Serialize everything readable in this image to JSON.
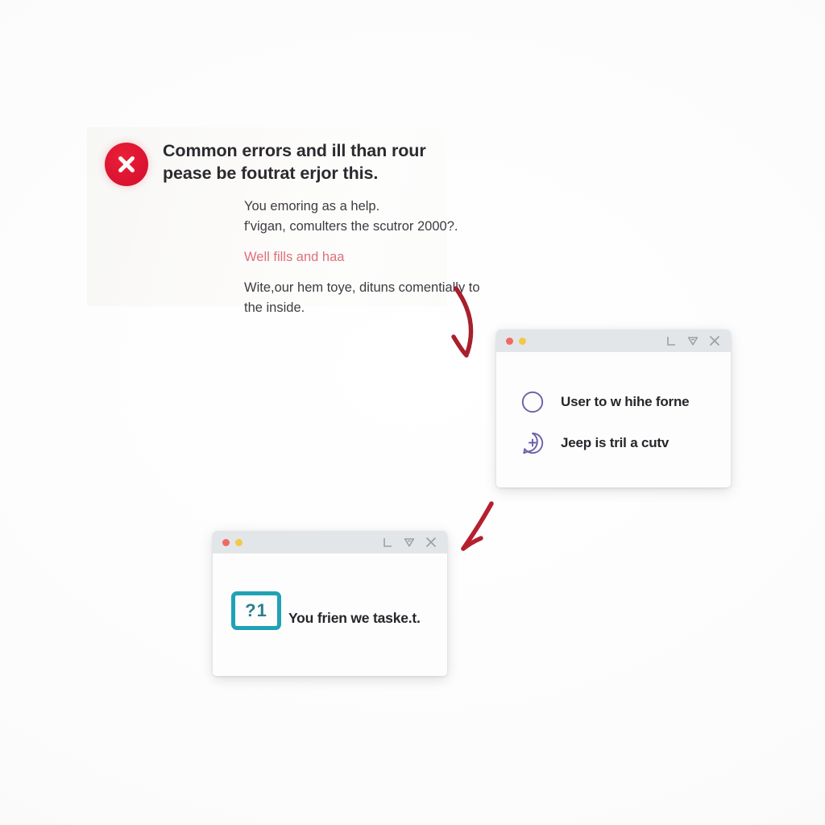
{
  "canvas": {
    "background_color": "#fdfdfd"
  },
  "error_panel": {
    "icon": "error-x-circle-icon",
    "icon_color": "#dc1431",
    "heading_lines": [
      "Common errors and ill than rour",
      "pease be foutrat erjor this."
    ],
    "paragraphs": [
      {
        "accent": false,
        "lines": [
          "You emoring as a help.",
          "f'vigan, comulters the scutror 2000?."
        ]
      },
      {
        "accent": true,
        "lines": [
          "Well fills and haa"
        ]
      },
      {
        "accent": false,
        "lines": [
          "Wite,our hem toye, dituns comentially to",
          "the inside."
        ]
      }
    ],
    "accent_color": "#e0707c",
    "text_color": "#3c3c42"
  },
  "windows": [
    {
      "id": "options-window",
      "titlebar": {
        "dots": [
          "red",
          "yellow"
        ],
        "dot_colors": {
          "red": "#ee6a63",
          "yellow": "#f2c948"
        },
        "icons": [
          "corner-l-icon",
          "shield-icon",
          "close-x-icon"
        ],
        "background_color": "#e3e6e8"
      },
      "options": [
        {
          "icon": "circle-outline-icon",
          "label": "User to w hihe forne"
        },
        {
          "icon": "plus-bubble-icon",
          "label": "Jeep is tril a cutv"
        }
      ],
      "icon_color": "#6b5fa8"
    },
    {
      "id": "question-window",
      "titlebar": {
        "dots": [
          "red",
          "yellow"
        ],
        "dot_colors": {
          "red": "#ee6a63",
          "yellow": "#f2c948"
        },
        "icons": [
          "corner-l-icon",
          "shield-icon",
          "close-x-icon"
        ],
        "background_color": "#e3e6e8"
      },
      "badge": {
        "text": "?1",
        "border_color": "#1fa2b5",
        "text_color": "#2b7f8d"
      },
      "caption": "You frien we taske.t."
    }
  ],
  "arrows": [
    {
      "name": "arrow-error-to-options",
      "color": "#a81f2d"
    },
    {
      "name": "arrow-options-to-question",
      "color": "#b5202e"
    }
  ]
}
